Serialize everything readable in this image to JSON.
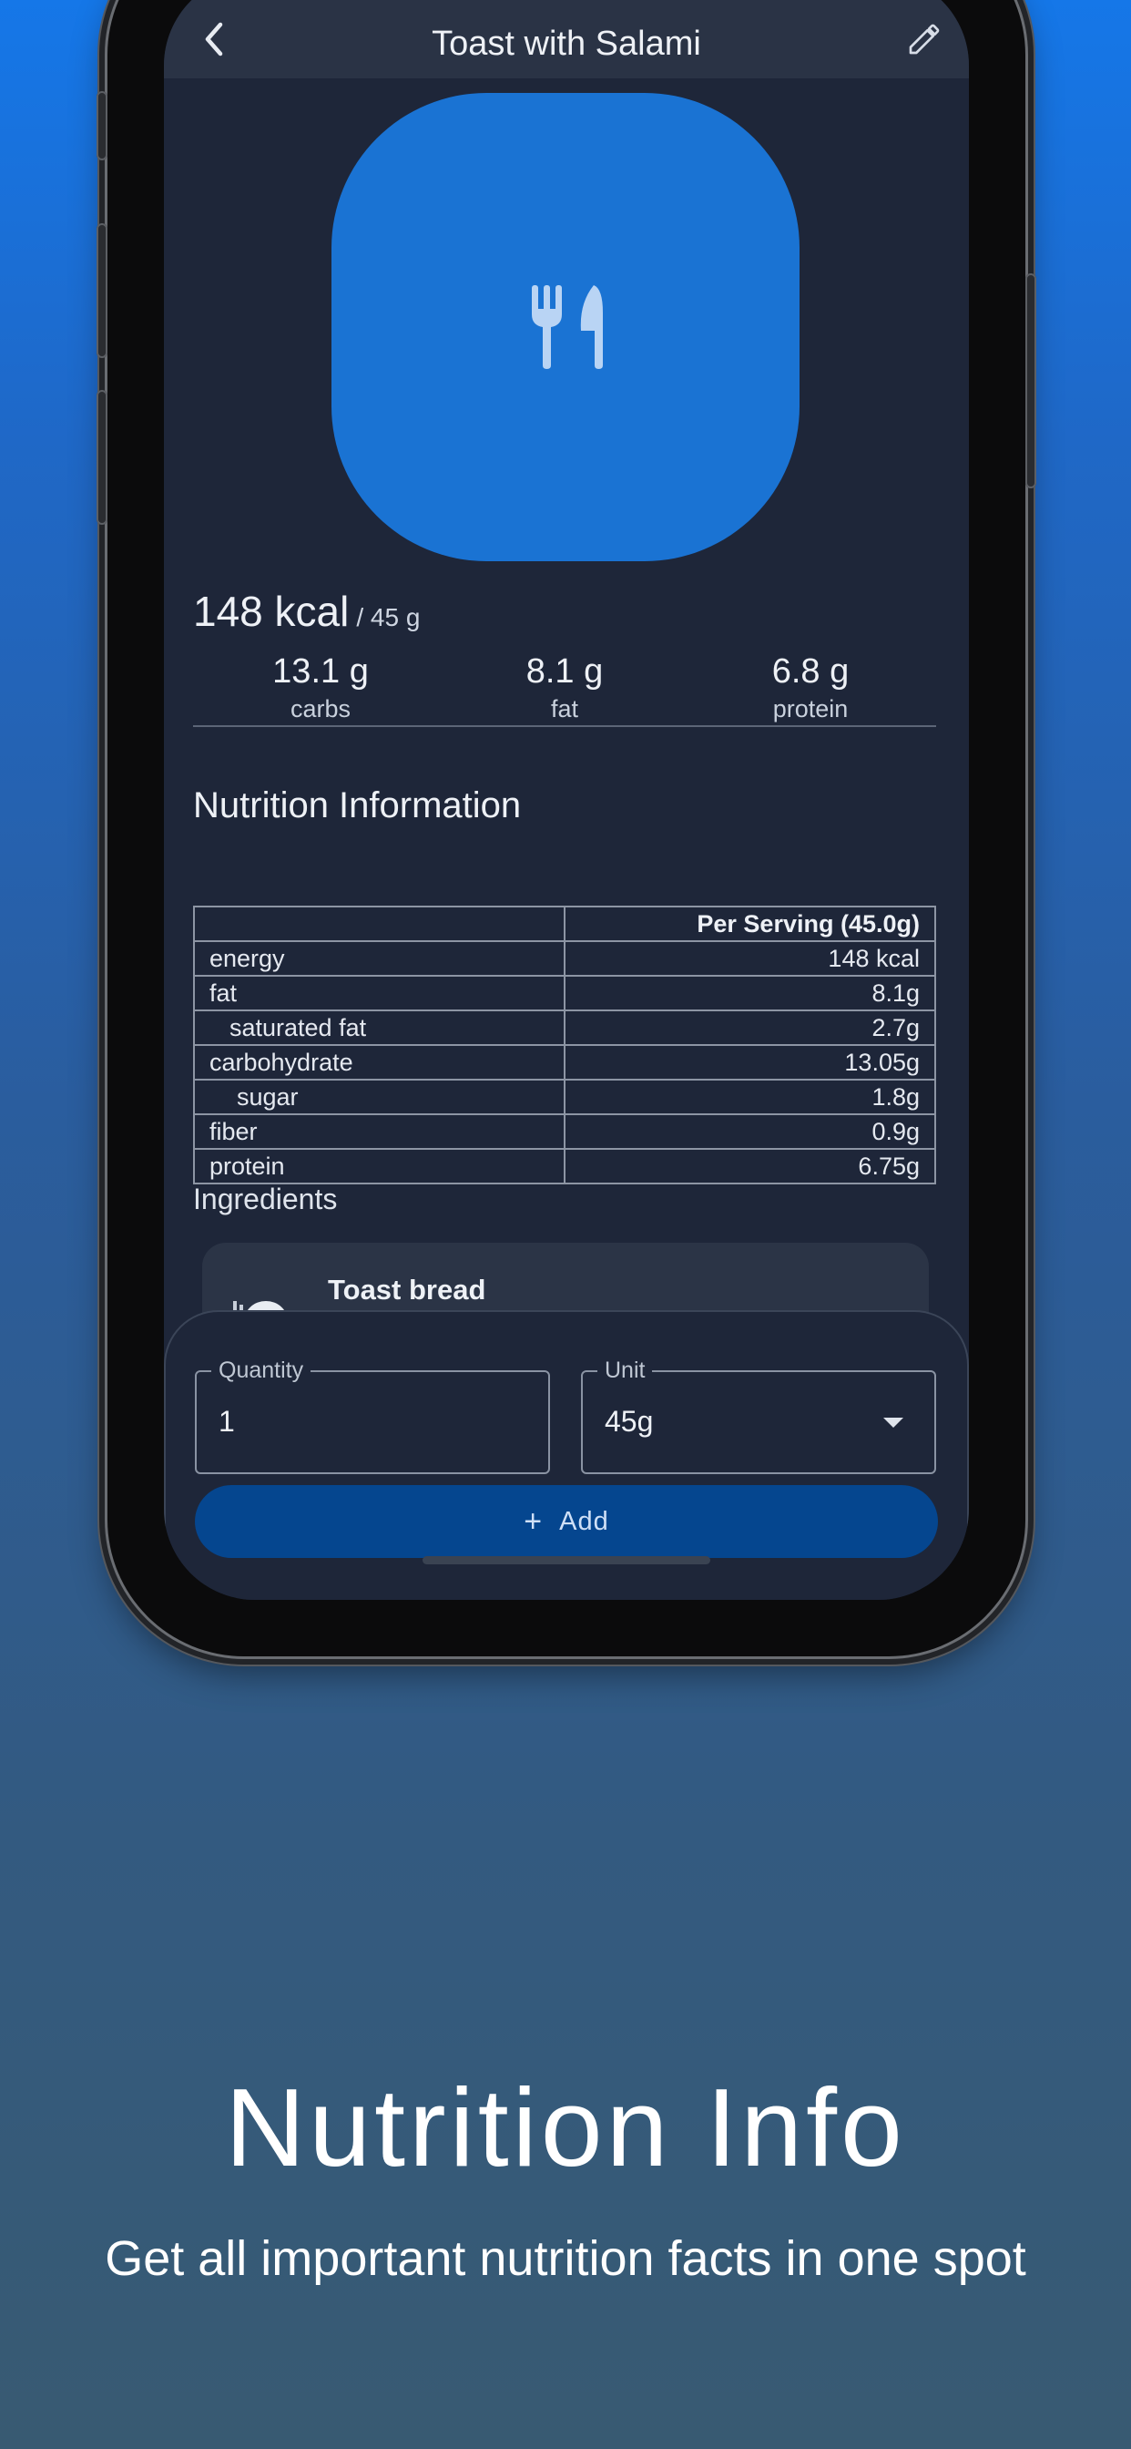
{
  "appbar": {
    "title": "Toast with Salami"
  },
  "summary": {
    "energy": "148 kcal",
    "portion": "/ 45 g",
    "macros": [
      {
        "value": "13.1 g",
        "label": "carbs"
      },
      {
        "value": "8.1 g",
        "label": "fat"
      },
      {
        "value": "6.8 g",
        "label": "protein"
      }
    ]
  },
  "nutrition": {
    "title": "Nutrition Information",
    "header": "Per Serving (45.0g)",
    "rows": [
      {
        "name": "energy",
        "value": "148 kcal"
      },
      {
        "name": "fat",
        "value": "8.1g"
      },
      {
        "name": "saturated fat",
        "value": "2.7g"
      },
      {
        "name": "carbohydrate",
        "value": "13.05g"
      },
      {
        "name": "sugar",
        "value": "1.8g"
      },
      {
        "name": "fiber",
        "value": "0.9g"
      },
      {
        "name": "protein",
        "value": "6.75g"
      }
    ]
  },
  "ingredients": {
    "title": "Ingredients",
    "items": [
      {
        "name": "Toast bread",
        "icon": "dish-icon"
      }
    ]
  },
  "sheet": {
    "quantity_label": "Quantity",
    "quantity_value": "1",
    "unit_label": "Unit",
    "unit_value": "45g",
    "add_label": "Add"
  },
  "promo": {
    "headline": "Nutrition Info",
    "subline": "Get all important nutrition facts in one spot"
  },
  "colors": {
    "accent": "#1a73d3",
    "button": "#05468f",
    "surface": "#1e2639"
  }
}
